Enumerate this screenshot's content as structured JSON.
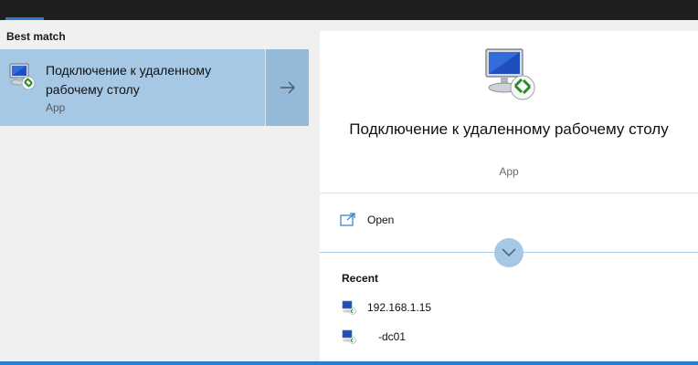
{
  "section": {
    "best_match": "Best match"
  },
  "result": {
    "title": "Подключение к удаленному рабочему столу",
    "subtitle": "App",
    "icon": "remote-desktop-icon"
  },
  "details": {
    "title": "Подключение к удаленному рабочему столу",
    "subtitle": "App",
    "open_label": "Open",
    "recent_header": "Recent",
    "recent": [
      {
        "label": "192.168.1.15"
      },
      {
        "label": "-dc01"
      }
    ]
  },
  "colors": {
    "selected_bg": "#a6c8e5",
    "arrow_bg": "#94b9d9",
    "accent": "#2b7cd3",
    "topbar": "#1f1f1f"
  }
}
